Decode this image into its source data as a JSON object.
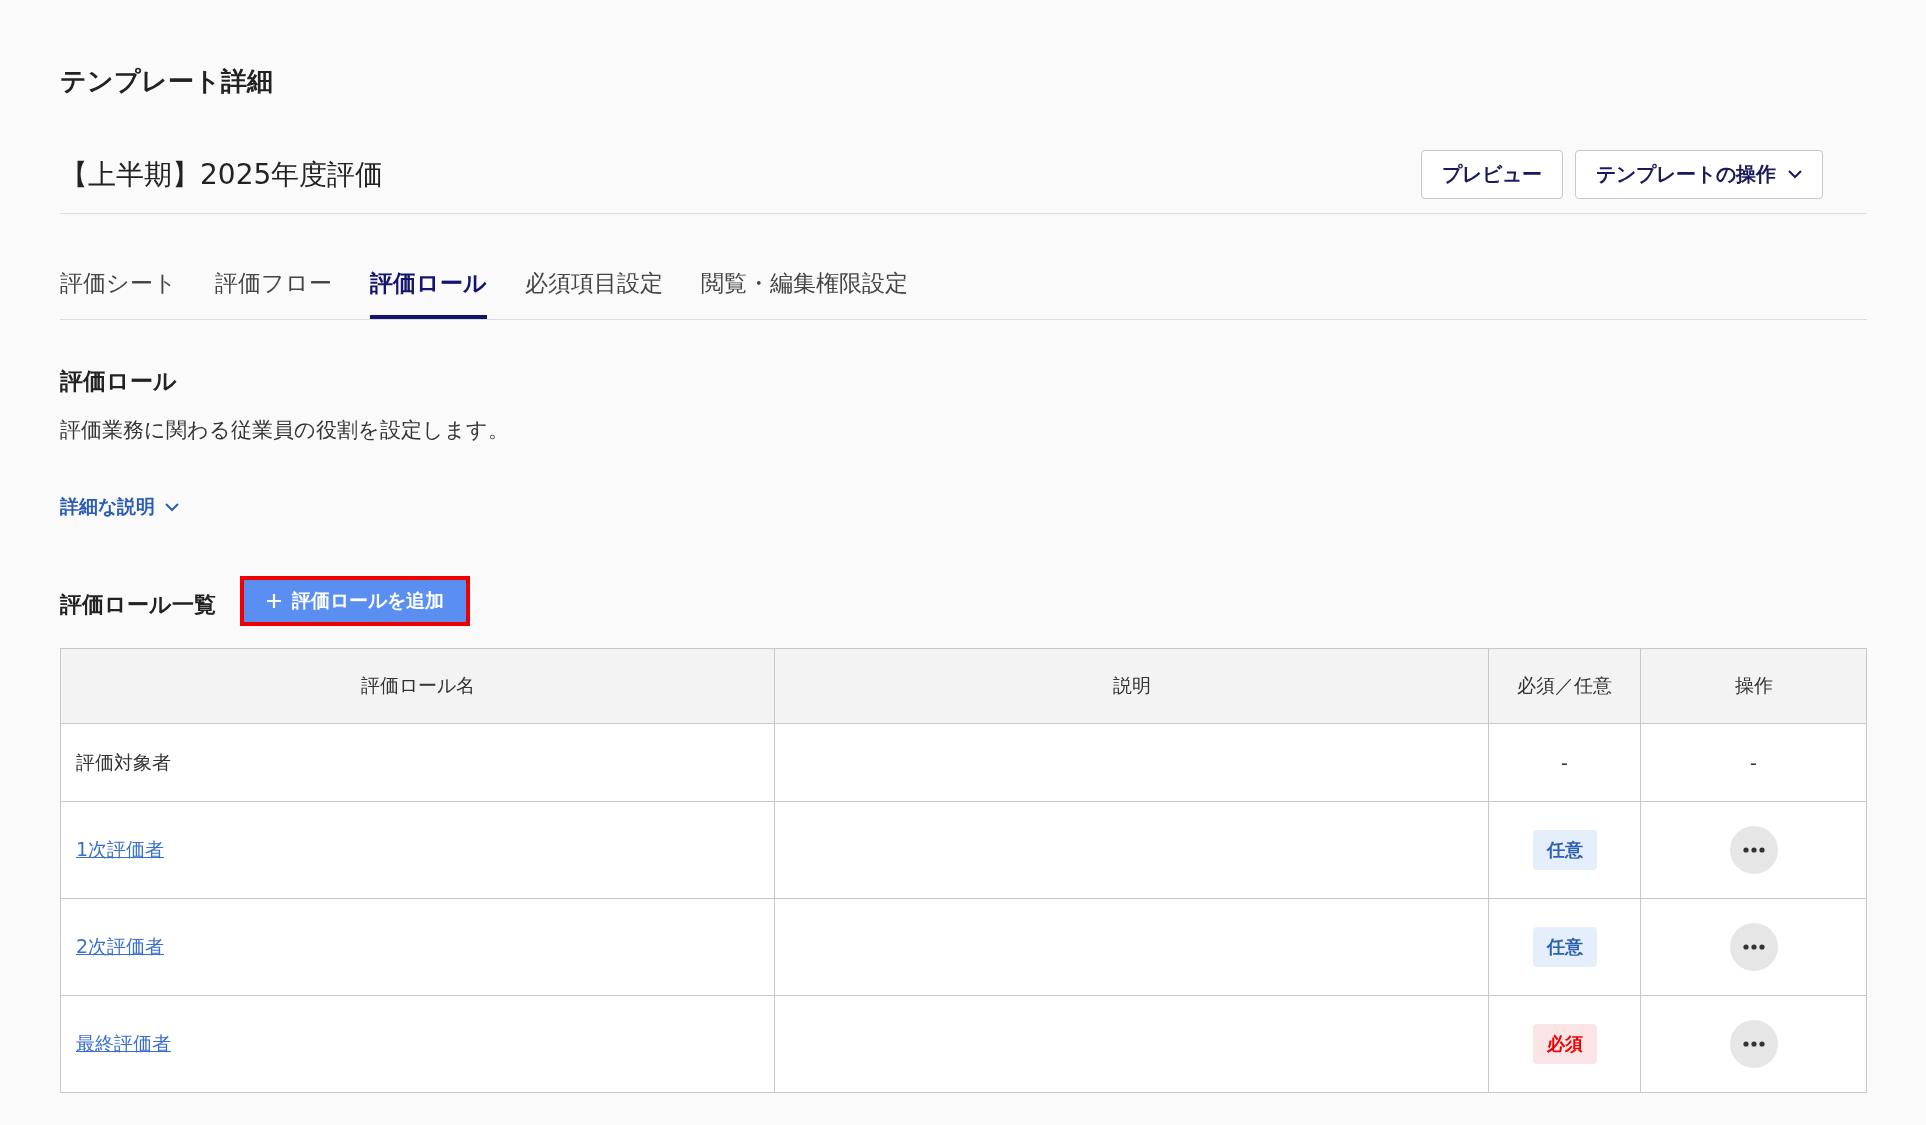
{
  "page_title": "テンプレート詳細",
  "template": {
    "name": "【上半期】2025年度評価",
    "buttons": [
      {
        "label": "プレビュー",
        "dropdown": false
      },
      {
        "label": "テンプレートの操作",
        "dropdown": true
      }
    ]
  },
  "tabs": [
    {
      "label": "評価シート",
      "selected": false
    },
    {
      "label": "評価フロー",
      "selected": false
    },
    {
      "label": "評価ロール",
      "selected": true
    },
    {
      "label": "必須項目設定",
      "selected": false
    },
    {
      "label": "閲覧・編集権限設定",
      "selected": false
    }
  ],
  "section": {
    "title": "評価ロール",
    "description": "評価業務に関わる従業員の役割を設定します。",
    "details_toggle": {
      "label": "詳細な説明",
      "expanded": false
    }
  },
  "role_list": {
    "title": "評価ロール一覧",
    "add_button": {
      "label": "評価ロールを追加",
      "highlighted": true
    },
    "columns": [
      "評価ロール名",
      "説明",
      "必須／任意",
      "操作"
    ],
    "rows": [
      {
        "name": "評価対象者",
        "link": false,
        "requirement": {
          "kind": "none",
          "label": "-"
        },
        "actions": {
          "kind": "none",
          "label": "-"
        }
      },
      {
        "name": "1次評価者",
        "link": true,
        "requirement": {
          "kind": "optional",
          "label": "任意"
        },
        "actions": {
          "kind": "menu"
        }
      },
      {
        "name": "2次評価者",
        "link": true,
        "requirement": {
          "kind": "optional",
          "label": "任意"
        },
        "actions": {
          "kind": "menu"
        }
      },
      {
        "name": "最終評価者",
        "link": true,
        "requirement": {
          "kind": "required",
          "label": "必須"
        },
        "actions": {
          "kind": "menu"
        }
      }
    ]
  }
}
